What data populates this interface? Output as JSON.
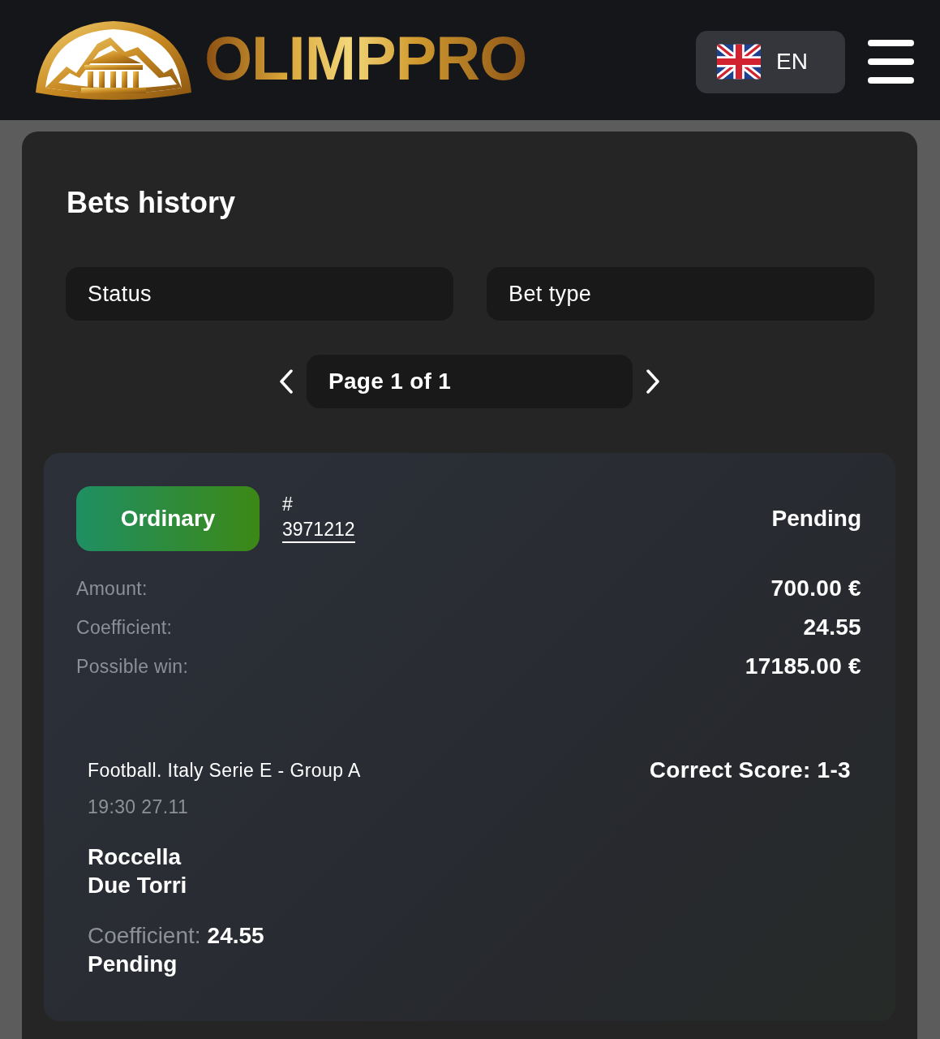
{
  "header": {
    "logo_text": "OLIMPPRO",
    "language": {
      "code": "EN"
    }
  },
  "panel": {
    "title": "Bets history",
    "filters": [
      {
        "label": "Status"
      },
      {
        "label": "Bet type"
      }
    ],
    "pagination": {
      "label": "Page 1 of 1"
    }
  },
  "bets": [
    {
      "type": "Ordinary",
      "number_prefix": "#",
      "number": "3971212",
      "status": "Pending",
      "details": [
        {
          "label": "Amount:",
          "value": "700.00 €"
        },
        {
          "label": "Coefficient:",
          "value": "24.55"
        },
        {
          "label": "Possible win:",
          "value": "17185.00 €"
        }
      ],
      "events": [
        {
          "league": "Football. Italy Serie E - Group A",
          "market": "Correct Score: 1-3",
          "time": "19:30 27.11",
          "teams": [
            "Roccella",
            "Due Torri"
          ],
          "coefficient_label": "Coefficient:",
          "coefficient": "24.55",
          "status": "Pending"
        }
      ]
    }
  ]
}
